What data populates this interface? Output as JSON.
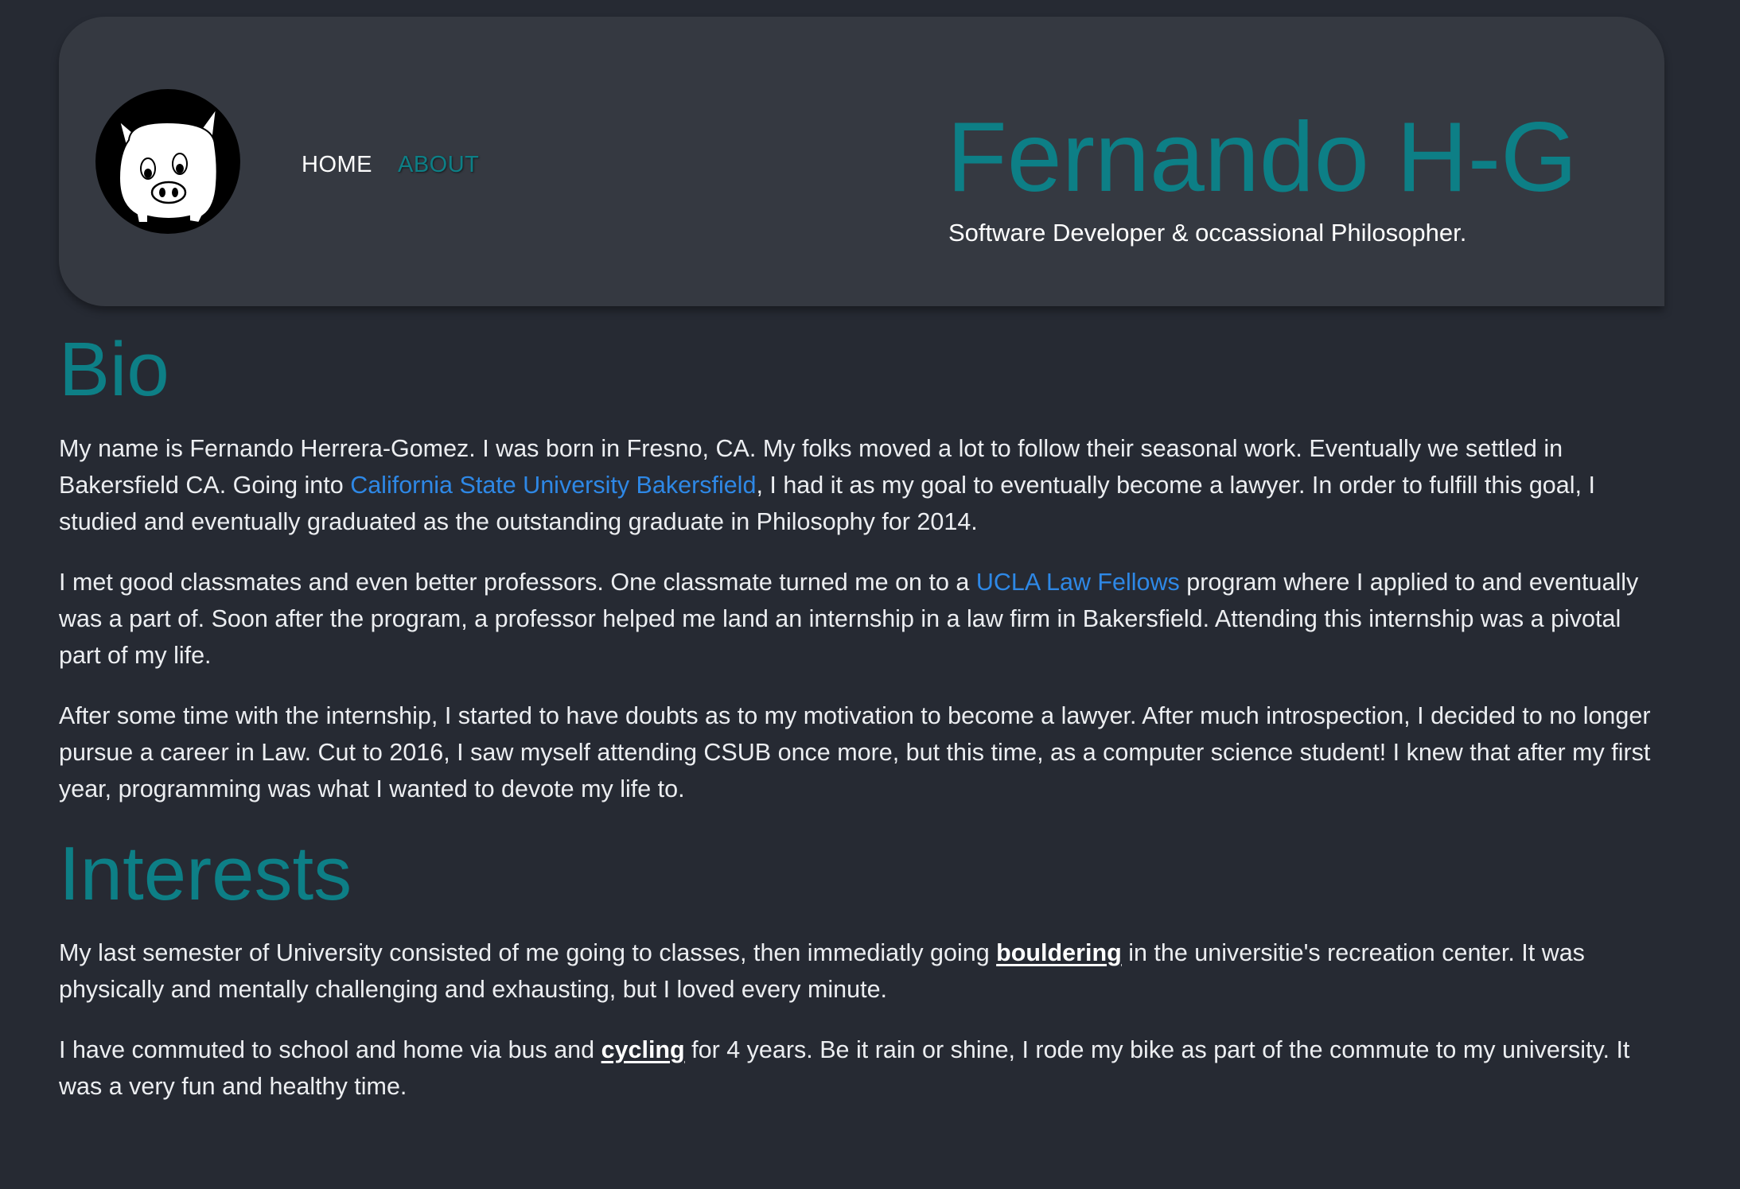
{
  "header": {
    "avatar_alt": "pig-logo",
    "nav": {
      "home": "HOME",
      "about": "ABOUT"
    },
    "name": "Fernando H-G",
    "tagline": "Software Developer & occassional Philosopher."
  },
  "colors": {
    "background": "#262a33",
    "header_bg": "#353941",
    "accent": "#0d7f86",
    "link": "#2e88e6",
    "text": "#eceef1"
  },
  "bio": {
    "title": "Bio",
    "p1": {
      "before": "My name is Fernando Herrera-Gomez. I was born in Fresno, CA. My folks moved a lot to follow their seasonal work. Eventually we settled in Bakersfield CA. Going into ",
      "link": "California State University Bakersfield",
      "after": ", I had it as my goal to eventually become a lawyer. In order to fulfill this goal, I studied and eventually graduated as the outstanding graduate in Philosophy for 2014."
    },
    "p2": {
      "before": "I met good classmates and even better professors. One classmate turned me on to a ",
      "link": "UCLA Law Fellows",
      "after": " program where I applied to and eventually was a part of. Soon after the program, a professor helped me land an internship in a law firm in Bakersfield. Attending this internship was a pivotal part of my life."
    },
    "p3": "After some time with the internship, I started to have doubts as to my motivation to become a lawyer. After much introspection, I decided to no longer pursue a career in Law. Cut to 2016, I saw myself attending CSUB once more, but this time, as a computer science student! I knew that after my first year, programming was what I wanted to devote my life to."
  },
  "interests": {
    "title": "Interests",
    "p1": {
      "before": "My last semester of University consisted of me going to classes, then immediatly going ",
      "link": "bouldering",
      "after": " in the universitie's recreation center. It was physically and mentally challenging and exhausting, but I loved every minute."
    },
    "p2": {
      "before": "I have commuted to school and home via bus and ",
      "link": "cycling",
      "after": " for 4 years. Be it rain or shine, I rode my bike as part of the commute to my university. It was a very fun and healthy time."
    }
  }
}
